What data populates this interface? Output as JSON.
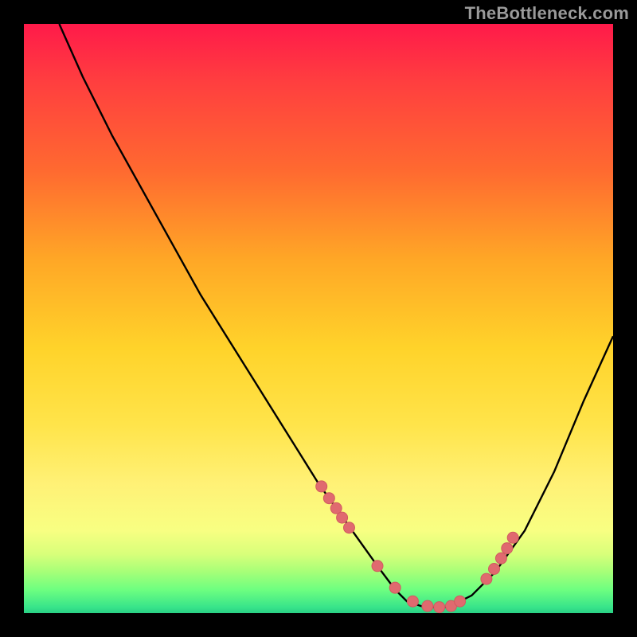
{
  "watermark": "TheBottleneck.com",
  "chart_data": {
    "type": "line",
    "title": "",
    "xlabel": "",
    "ylabel": "",
    "xlim": [
      0,
      100
    ],
    "ylim": [
      0,
      100
    ],
    "grid": false,
    "legend": false,
    "series": [
      {
        "name": "curve",
        "stroke": "#000000",
        "x": [
          6,
          10,
          15,
          20,
          25,
          30,
          35,
          40,
          45,
          50,
          55,
          60,
          63,
          65,
          68,
          72,
          76,
          80,
          85,
          90,
          95,
          100
        ],
        "y": [
          100,
          91,
          81,
          72,
          63,
          54,
          46,
          38,
          30,
          22,
          15,
          8,
          4,
          2,
          1,
          1,
          3,
          7,
          14,
          24,
          36,
          47
        ]
      }
    ],
    "markers": {
      "name": "dots",
      "fill": "#e06a6f",
      "stroke": "#d15b60",
      "r": 7,
      "x": [
        50.5,
        51.8,
        53.0,
        54.0,
        55.2,
        60.0,
        63.0,
        66.0,
        68.5,
        70.5,
        72.5,
        74.0,
        78.5,
        79.8,
        81.0,
        82.0,
        83.0
      ],
      "y": [
        21.5,
        19.5,
        17.8,
        16.2,
        14.5,
        8.0,
        4.3,
        2.0,
        1.2,
        1.0,
        1.2,
        2.0,
        5.8,
        7.5,
        9.3,
        11.0,
        12.8
      ]
    }
  }
}
